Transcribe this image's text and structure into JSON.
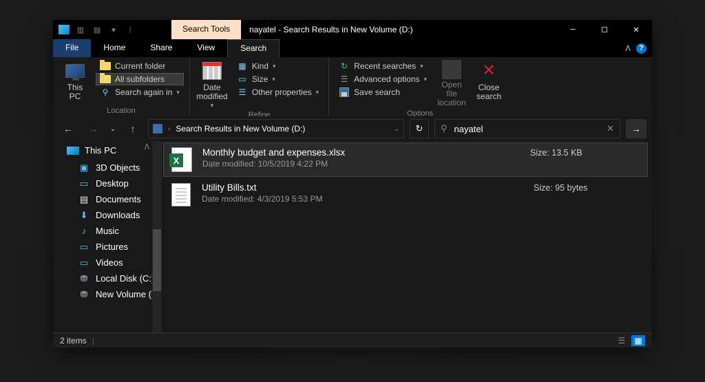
{
  "title_tab": "Search Tools",
  "window_title": "nayatel - Search Results in New Volume (D:)",
  "menus": {
    "file": "File",
    "home": "Home",
    "share": "Share",
    "view": "View",
    "search": "Search"
  },
  "ribbon": {
    "location": {
      "this_pc": "This\nPC",
      "current_folder": "Current folder",
      "all_subfolders": "All subfolders",
      "search_again_in": "Search again in",
      "group_label": "Location"
    },
    "refine": {
      "date_modified": "Date\nmodified",
      "kind": "Kind",
      "size": "Size",
      "other_properties": "Other properties",
      "group_label": "Refine"
    },
    "options": {
      "recent_searches": "Recent searches",
      "advanced_options": "Advanced options",
      "save_search": "Save search",
      "open_file_location": "Open file\nlocation",
      "close_search": "Close\nsearch",
      "group_label": "Options"
    }
  },
  "address": "Search Results in New Volume (D:)",
  "search_value": "nayatel",
  "sidebar": {
    "this_pc": "This PC",
    "items": [
      "3D Objects",
      "Desktop",
      "Documents",
      "Downloads",
      "Music",
      "Pictures",
      "Videos",
      "Local Disk (C:)",
      "New Volume (D:)"
    ]
  },
  "results": [
    {
      "name": "Monthly budget and expenses.xlsx",
      "date_label": "Date modified: 10/5/2019 4:22 PM",
      "size_label": "Size: 13.5 KB",
      "type": "xlsx",
      "selected": true
    },
    {
      "name": "Utility Bills.txt",
      "date_label": "Date modified: 4/3/2019 5:53 PM",
      "size_label": "Size: 95 bytes",
      "type": "txt",
      "selected": false
    }
  ],
  "status": "2 items"
}
